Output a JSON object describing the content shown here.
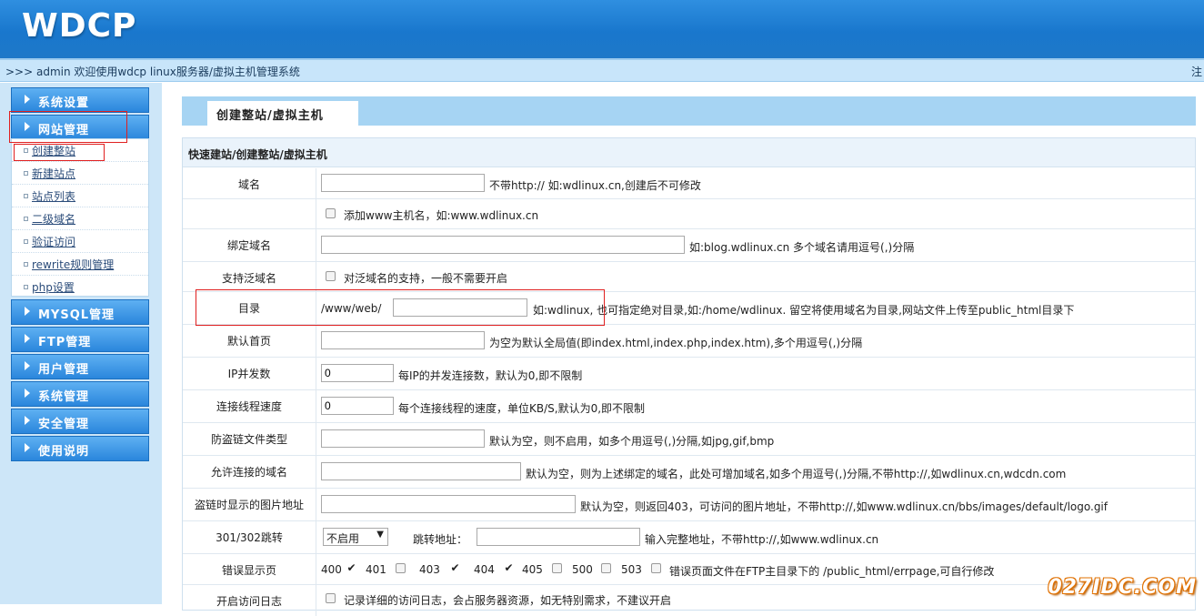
{
  "header": {
    "logo": "WDCP"
  },
  "topbar": {
    "text": ">>> admin 欢迎使用wdcp linux服务器/虚拟主机管理系统",
    "right": "注"
  },
  "sidebar": {
    "menus": [
      {
        "label": "系统设置"
      },
      {
        "label": "网站管理"
      },
      {
        "label": "MYSQL管理"
      },
      {
        "label": "FTP管理"
      },
      {
        "label": "用户管理"
      },
      {
        "label": "系统管理"
      },
      {
        "label": "安全管理"
      },
      {
        "label": "使用说明"
      }
    ],
    "submenu": [
      {
        "label": "创建整站"
      },
      {
        "label": "新建站点"
      },
      {
        "label": "站点列表"
      },
      {
        "label": "二级域名"
      },
      {
        "label": "验证访问"
      },
      {
        "label": "rewrite规则管理"
      },
      {
        "label": "php设置"
      }
    ]
  },
  "main": {
    "tab": "创建整站/虚拟主机",
    "panel_title": "快速建站/创建整站/虚拟主机",
    "rows": {
      "domain": {
        "label": "域名",
        "value": "",
        "hint": "不带http:// 如:wdlinux.cn,创建后不可修改"
      },
      "www": {
        "checked": false,
        "hint": "添加www主机名，如:www.wdlinux.cn"
      },
      "bind": {
        "label": "绑定域名",
        "value": "",
        "hint": "如:blog.wdlinux.cn 多个域名请用逗号(,)分隔"
      },
      "wildcard": {
        "label": "支持泛域名",
        "checked": false,
        "hint": "对泛域名的支持，一般不需要开启"
      },
      "dir": {
        "label": "目录",
        "prefix": "/www/web/",
        "value": "",
        "hint": "如:wdlinux, 也可指定绝对目录,如:/home/wdlinux. 留空将使用域名为目录,网站文件上传至public_html目录下"
      },
      "index": {
        "label": "默认首页",
        "value": "",
        "hint": "为空为默认全局值(即index.html,index.php,index.htm),多个用逗号(,)分隔"
      },
      "ipconn": {
        "label": "IP并发数",
        "value": "0",
        "hint": "每IP的并发连接数，默认为0,即不限制"
      },
      "speed": {
        "label": "连接线程速度",
        "value": "0",
        "hint": "每个连接线程的速度，单位KB/S,默认为0,即不限制"
      },
      "antileech": {
        "label": "防盗链文件类型",
        "value": "",
        "hint": "默认为空，则不启用，如多个用逗号(,)分隔,如jpg,gif,bmp"
      },
      "allowed": {
        "label": "允许连接的域名",
        "value": "",
        "hint": "默认为空，则为上述绑定的域名，此处可增加域名,如多个用逗号(,)分隔,不带http://,如wdlinux.cn,wdcdn.com"
      },
      "leechimg": {
        "label": "盗链时显示的图片地址",
        "value": "",
        "hint": "默认为空，则返回403，可访问的图片地址，不带http://,如www.wdlinux.cn/bbs/images/default/logo.gif"
      },
      "redirect": {
        "label": "301/302跳转",
        "select": "不启用",
        "target_label": "跳转地址：",
        "value": "",
        "hint": "输入完整地址，不带http://,如www.wdlinux.cn"
      },
      "errpage": {
        "label": "错误显示页",
        "codes": [
          {
            "code": "400",
            "checked": true
          },
          {
            "code": "401",
            "checked": false
          },
          {
            "code": "403",
            "checked": true
          },
          {
            "code": "404",
            "checked": true
          },
          {
            "code": "405",
            "checked": false
          },
          {
            "code": "500",
            "checked": false
          },
          {
            "code": "503",
            "checked": false
          }
        ],
        "hint": "错误页面文件在FTP主目录下的 /public_html/errpage,可自行修改"
      },
      "accesslog": {
        "label": "开启访问日志",
        "checked": false,
        "hint": "记录详细的访问日志，会占服务器资源，如无特别需求，不建议开启"
      }
    }
  },
  "watermark": "027IDC.COM"
}
